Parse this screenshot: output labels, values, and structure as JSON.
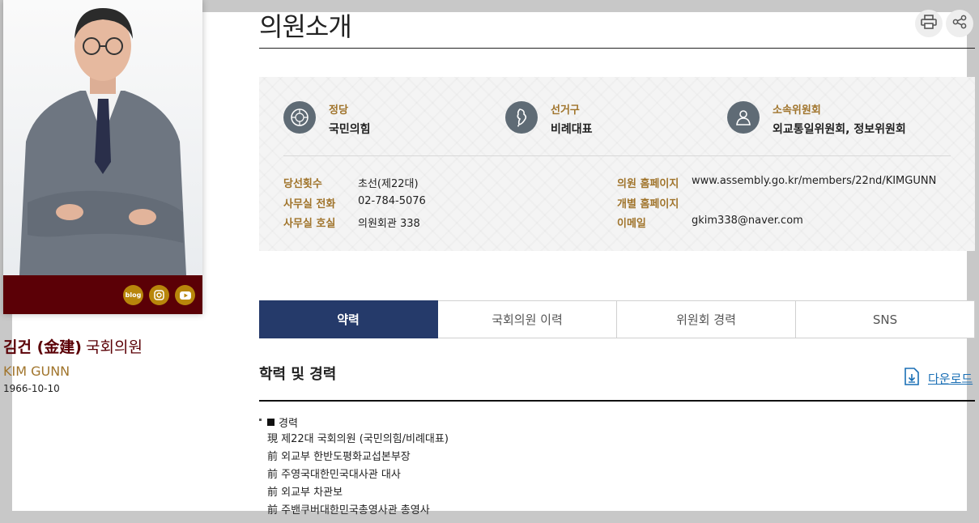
{
  "page": {
    "title": "의원소개"
  },
  "toolbar": {
    "print_icon": "printer-icon",
    "share_icon": "share-icon"
  },
  "member": {
    "name_ko": "김건 (金建)",
    "title": "국회의원",
    "name_en": "KIM GUNN",
    "birth": "1966-10-10",
    "sns": {
      "blog_label": "blog",
      "instagram_icon": "instagram-icon",
      "youtube_icon": "youtube-icon"
    }
  },
  "info": {
    "party": {
      "label": "정당",
      "value": "국민의힘",
      "icon": "party-emblem-icon"
    },
    "district": {
      "label": "선거구",
      "value": "비례대표",
      "icon": "korea-map-icon"
    },
    "committee": {
      "label": "소속위원회",
      "value": "외교통일위원회, 정보위원회",
      "icon": "person-icon"
    },
    "rows_left": [
      {
        "key": "당선횟수",
        "value": "초선(제22대)"
      },
      {
        "key": "사무실 전화",
        "value": "02-784-5076"
      },
      {
        "key": "사무실 호실",
        "value": "의원회관 338"
      }
    ],
    "rows_right": [
      {
        "key": "의원 홈페이지",
        "value": "www.assembly.go.kr/members/22nd/KIMGUNN"
      },
      {
        "key": "개별 홈페이지",
        "value": ""
      },
      {
        "key": "이메일",
        "value": "gkim338@naver.com"
      }
    ]
  },
  "tabs": [
    {
      "label": "약력",
      "active": true
    },
    {
      "label": "국회의원 이력",
      "active": false
    },
    {
      "label": "위원회 경력",
      "active": false
    },
    {
      "label": "SNS",
      "active": false
    }
  ],
  "career": {
    "title": "학력 및 경력",
    "download_label": "다운로드",
    "heading": "경력",
    "items": [
      "現 제22대 국회의원 (국민의힘/비례대표)",
      "前 외교부 한반도평화교섭본부장",
      "前 주영국대한민국대사관 대사",
      "前 외교부 차관보",
      "前 주밴쿠버대한민국총영사관 총영사"
    ]
  },
  "colors": {
    "accent_gold": "#a0742b",
    "maroon": "#5b0006",
    "tab_active": "#253a6a",
    "link": "#1a6fb5"
  }
}
